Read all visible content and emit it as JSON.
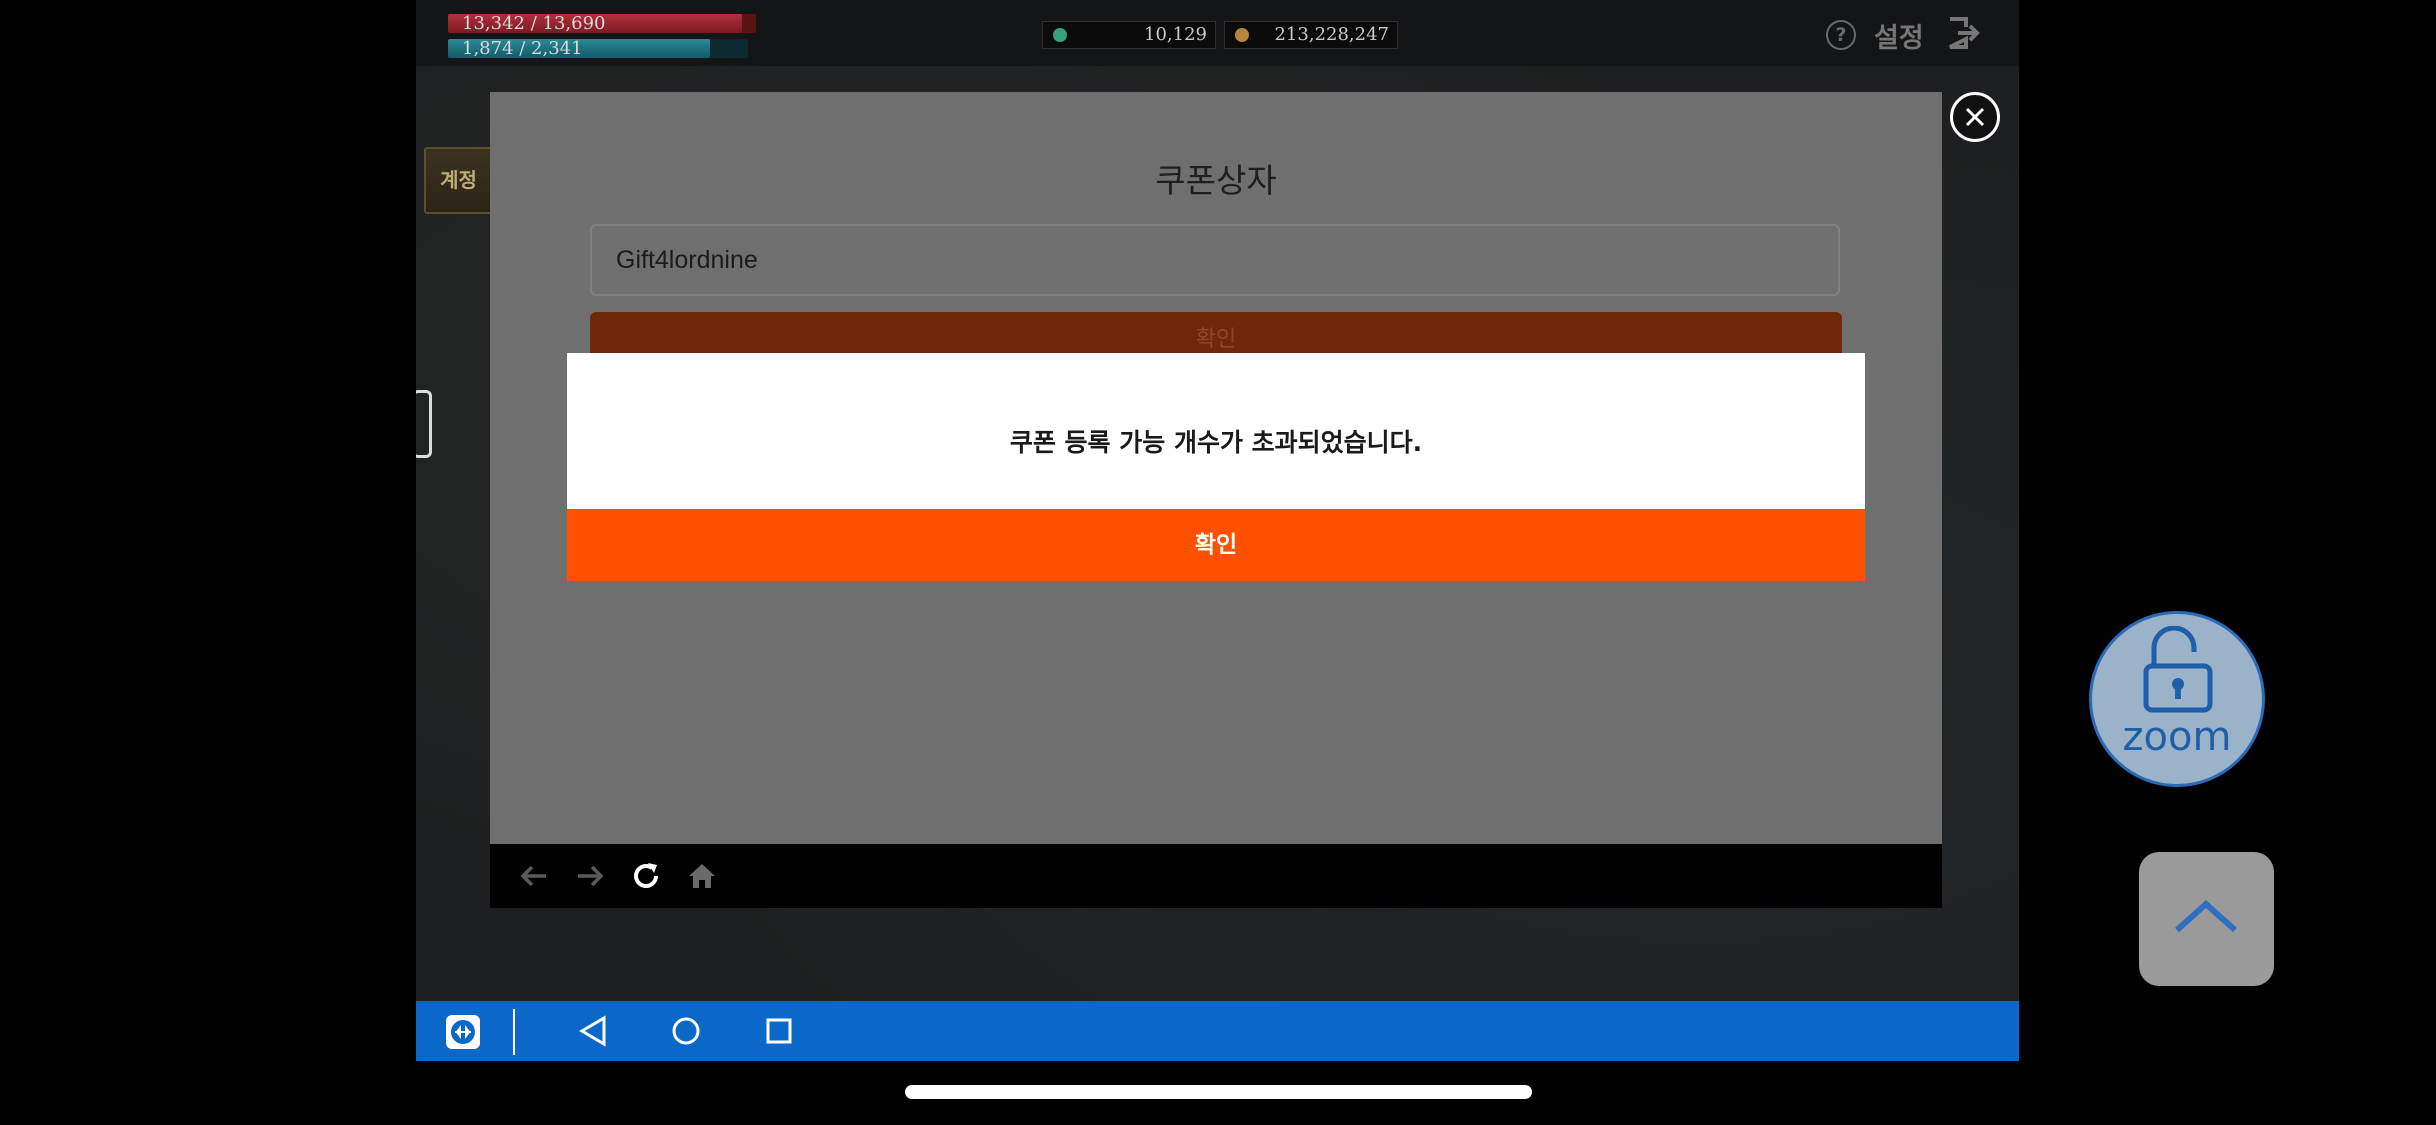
{
  "hud": {
    "hp_text": "13,342 / 13,690",
    "mp_text": "1,874 / 2,341",
    "gem_count": "10,129",
    "gold_count": "213,228,247",
    "help_icon": "question-circle-icon",
    "settings_label": "설정",
    "logout_icon": "logout-icon"
  },
  "side": {
    "account_tab_label": "계정"
  },
  "coupon": {
    "title": "쿠폰상자",
    "input_value": "Gift4lordnine",
    "confirm_label": "확인"
  },
  "alert": {
    "message": "쿠폰 등록 가능 개수가 초과되었습니다.",
    "confirm_label": "확인"
  },
  "web_nav": {
    "icons": [
      "back-arrow-icon",
      "forward-arrow-icon",
      "refresh-icon",
      "home-icon"
    ]
  },
  "overlay": {
    "zoom_label": "zoom",
    "lock_icon": "unlock-icon",
    "scroll_up_icon": "chevron-up-icon"
  },
  "colors": {
    "alert_confirm": "#ff5000",
    "android_nav": "#0b68c8",
    "zoom_accent": "#1f5ea8"
  }
}
